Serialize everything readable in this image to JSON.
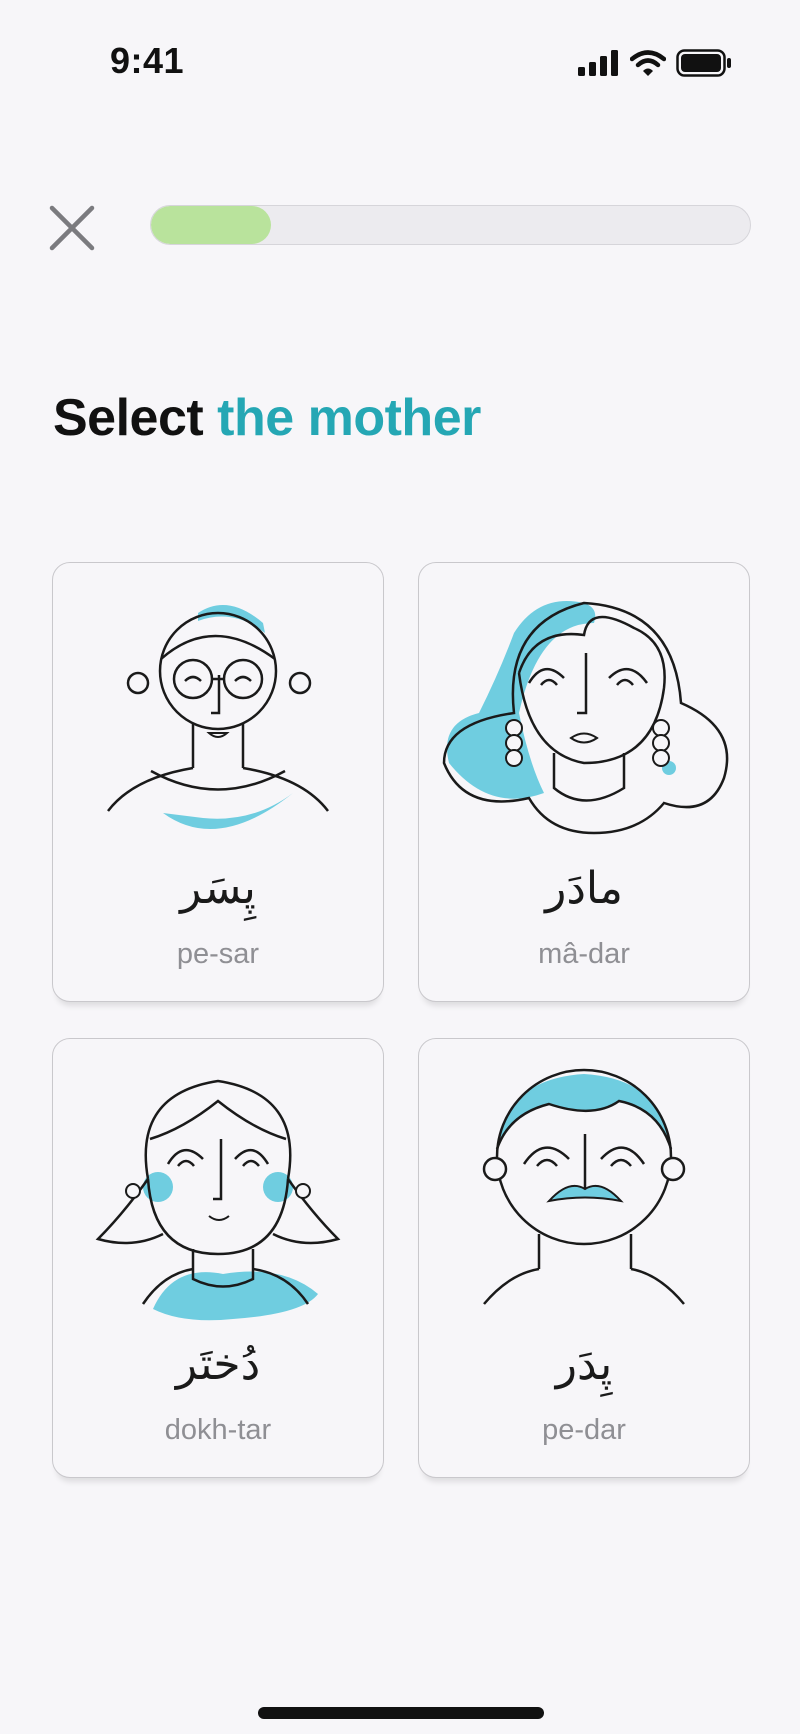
{
  "status_bar": {
    "time": "9:41",
    "icons": [
      "signal-icon",
      "wifi-icon",
      "battery-icon"
    ]
  },
  "lesson": {
    "progress": 0.2,
    "progress_color": "#b9e39c"
  },
  "prompt": {
    "prefix": "Select",
    "target": "the mother",
    "accent_color": "#25a7b4"
  },
  "cards": [
    {
      "native": "پِسَر",
      "translit": "pe-sar",
      "illustration": "son-illustration"
    },
    {
      "native": "مادَر",
      "translit": "mâ-dar",
      "illustration": "mother-illustration"
    },
    {
      "native": "دُختَر",
      "translit": "dokh-tar",
      "illustration": "daughter-illustration"
    },
    {
      "native": "پِدَر",
      "translit": "pe-dar",
      "illustration": "father-illustration"
    }
  ],
  "colors": {
    "illustration_fill": "#6fcde0",
    "line": "#1a1a1a"
  }
}
